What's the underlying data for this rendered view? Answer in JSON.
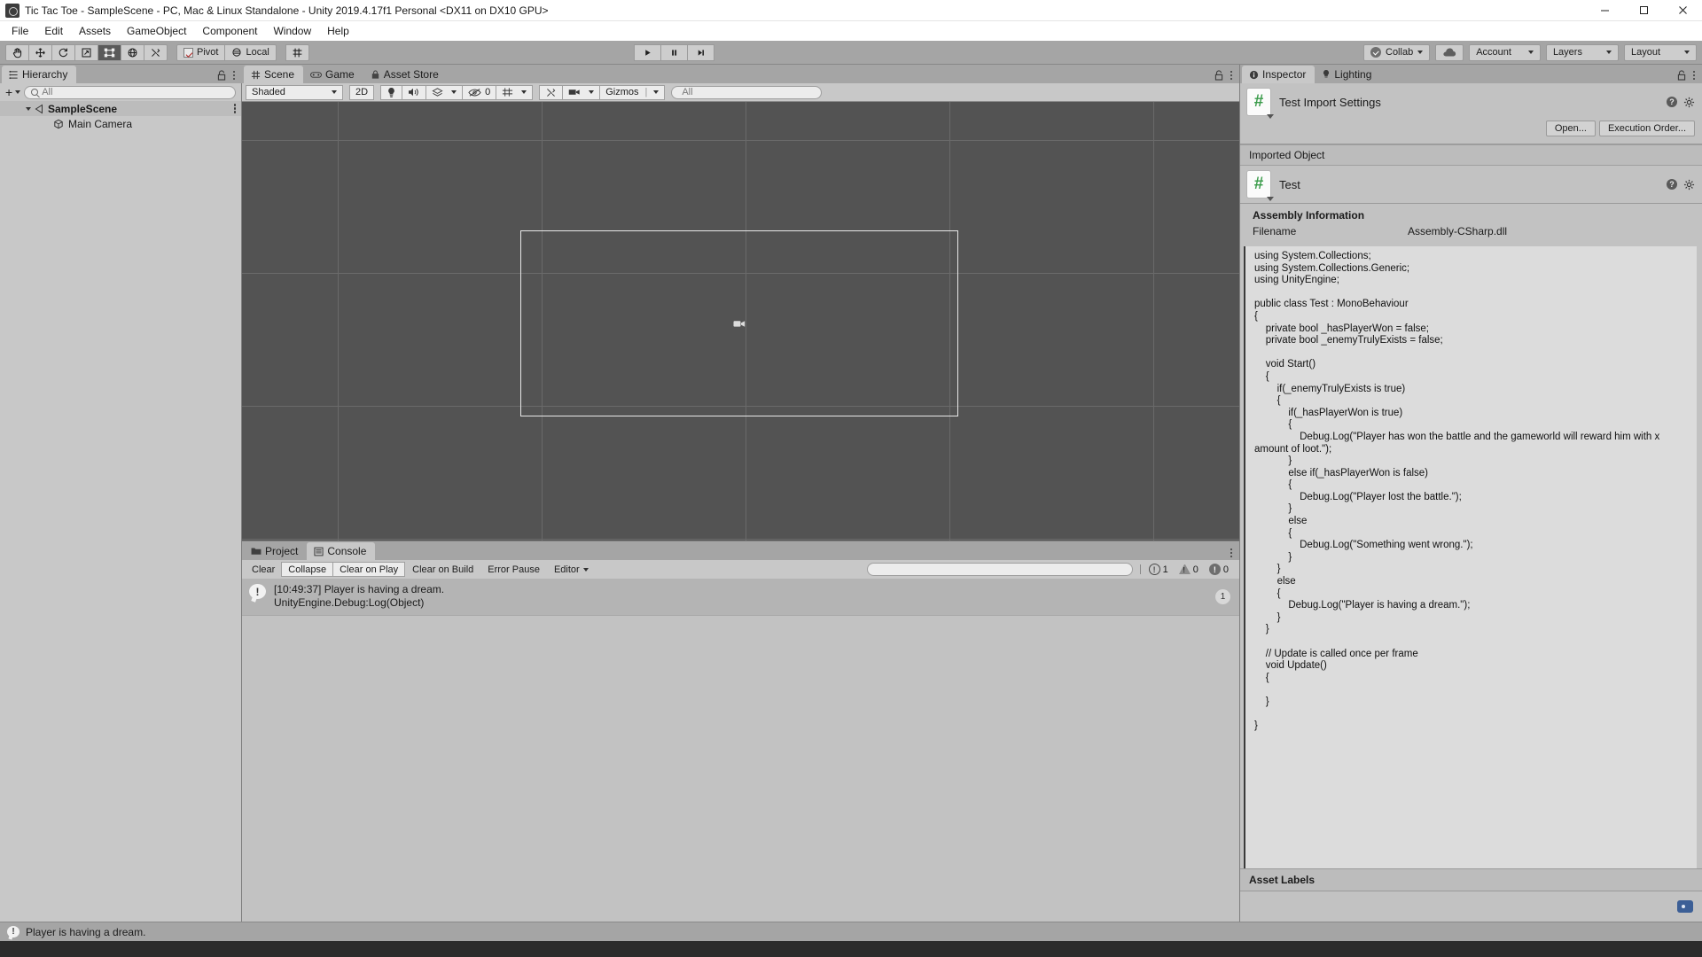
{
  "window": {
    "title": "Tic Tac Toe - SampleScene - PC, Mac & Linux Standalone - Unity 2019.4.17f1 Personal <DX11 on DX10 GPU>",
    "minimize": "–",
    "maximize": "❐",
    "close": "✕"
  },
  "menu": {
    "items": [
      {
        "label": "File"
      },
      {
        "label": "Edit"
      },
      {
        "label": "Assets"
      },
      {
        "label": "GameObject"
      },
      {
        "label": "Component"
      },
      {
        "label": "Window"
      },
      {
        "label": "Help"
      }
    ]
  },
  "toolbar": {
    "tools": [
      {
        "name": "hand-tool",
        "icon": "hand"
      },
      {
        "name": "move-tool",
        "icon": "move"
      },
      {
        "name": "rotate-tool",
        "icon": "rotate"
      },
      {
        "name": "scale-tool",
        "icon": "scale"
      },
      {
        "name": "rect-tool",
        "icon": "rect",
        "active": true
      },
      {
        "name": "transform-tool",
        "icon": "transform"
      },
      {
        "name": "custom-tool",
        "icon": "wrench"
      }
    ],
    "pivot_label": "Pivot",
    "local_label": "Local",
    "play_label": "▶",
    "pause_label": "❙❙",
    "step_label": "▶❙",
    "collab_label": "Collab",
    "cloud_label": "cloud",
    "account_label": "Account",
    "layers_label": "Layers",
    "layout_label": "Layout"
  },
  "hierarchy": {
    "tab_label": "Hierarchy",
    "create_label": "+",
    "search_placeholder": "All",
    "items": [
      {
        "label": "SampleScene",
        "bold": true,
        "expanded": true,
        "depth": 0
      },
      {
        "label": "Main Camera",
        "bold": false,
        "expanded": false,
        "depth": 1
      }
    ]
  },
  "scene": {
    "tabs": [
      {
        "label": "Scene",
        "active": true,
        "icon": "grid-icon"
      },
      {
        "label": "Game",
        "active": false,
        "icon": "gamepad-icon"
      },
      {
        "label": "Asset Store",
        "active": false,
        "icon": "store-icon"
      }
    ],
    "shading_mode": "Shaded",
    "mode_2d": "2D",
    "lighting_icon": "lightbulb-icon",
    "audio_icon": "speaker-icon",
    "fx_icon": "effects-icon",
    "hidden_count": "0",
    "grid_icon": "grid-visibility-icon",
    "gizmos_label": "Gizmos",
    "search_placeholder": "All"
  },
  "console": {
    "tabs": [
      {
        "label": "Project",
        "active": false,
        "icon": "folder-icon"
      },
      {
        "label": "Console",
        "active": true,
        "icon": "console-icon"
      }
    ],
    "buttons": [
      {
        "label": "Clear",
        "boxed": false
      },
      {
        "label": "Collapse",
        "boxed": true
      },
      {
        "label": "Clear on Play",
        "boxed": true
      },
      {
        "label": "Clear on Build",
        "boxed": false
      },
      {
        "label": "Error Pause",
        "boxed": false
      },
      {
        "label": "Editor",
        "boxed": false,
        "dropdown": true
      }
    ],
    "search_placeholder": "",
    "counters": {
      "errors": "1",
      "warnings": "0",
      "infos": "0"
    },
    "entries": [
      {
        "line1": "[10:49:37] Player is having a dream.",
        "line2": "UnityEngine.Debug:Log(Object)",
        "count": "1"
      }
    ]
  },
  "inspector": {
    "tabs": [
      {
        "label": "Inspector",
        "active": true,
        "icon": "info-icon"
      },
      {
        "label": "Lighting",
        "active": false,
        "icon": "lightbulb-icon"
      }
    ],
    "import_settings_title": "Test Import Settings",
    "open_button": "Open...",
    "execution_order_button": "Execution Order...",
    "imported_object_label": "Imported Object",
    "imported_object_name": "Test",
    "assembly_title": "Assembly Information",
    "filename_label": "Filename",
    "filename_value": "Assembly-CSharp.dll",
    "script_icon_glyph": "#",
    "source_code": "using System.Collections;\nusing System.Collections.Generic;\nusing UnityEngine;\n\npublic class Test : MonoBehaviour\n{\n    private bool _hasPlayerWon = false;\n    private bool _enemyTrulyExists = false;\n\n    void Start()\n    {\n        if(_enemyTrulyExists is true)\n        {\n            if(_hasPlayerWon is true)\n            {\n                Debug.Log(\"Player has won the battle and the gameworld will reward him with x amount of loot.\");\n            }\n            else if(_hasPlayerWon is false)\n            {\n                Debug.Log(\"Player lost the battle.\");\n            }\n            else\n            {\n                Debug.Log(\"Something went wrong.\");\n            }\n        }\n        else\n        {\n            Debug.Log(\"Player is having a dream.\");\n        }\n    }\n\n    // Update is called once per frame\n    void Update()\n    {\n\n    }\n\n}",
    "asset_labels_label": "Asset Labels"
  },
  "statusbar": {
    "message": "Player is having a dream."
  },
  "colors": {
    "accent_green": "#3a9b4a",
    "panel_bg": "#c2c2c2",
    "toolbar_bg": "#a5a5a5",
    "scene_bg": "#535353"
  }
}
